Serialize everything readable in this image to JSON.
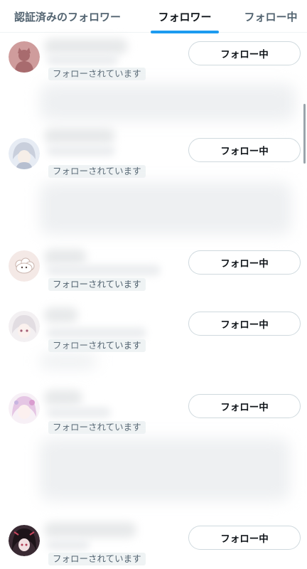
{
  "tabs": [
    {
      "label": "認証済みのフォロワー",
      "active": false
    },
    {
      "label": "フォロワー",
      "active": true
    },
    {
      "label": "フォロー中",
      "active": false
    }
  ],
  "accent_color": "#1d9bf0",
  "users": [
    {
      "avatar": "cat-avatar-icon",
      "follows_you": "フォローされています",
      "button": "フォロー中"
    },
    {
      "avatar": "anime-girl-avatar-icon",
      "follows_you": "フォローされています",
      "button": "フォロー中"
    },
    {
      "avatar": "sheep-avatar-icon",
      "follows_you": "フォローされています",
      "button": "フォロー中"
    },
    {
      "avatar": "anime-girl-avatar-icon",
      "follows_you": "フォローされています",
      "button": "フォロー中"
    },
    {
      "avatar": "anime-girl-avatar-icon",
      "follows_you": "フォローされています",
      "button": "フォロー中"
    },
    {
      "avatar": "dark-anime-avatar-icon",
      "follows_you": "フォローされています",
      "button": "フォロー中"
    }
  ]
}
